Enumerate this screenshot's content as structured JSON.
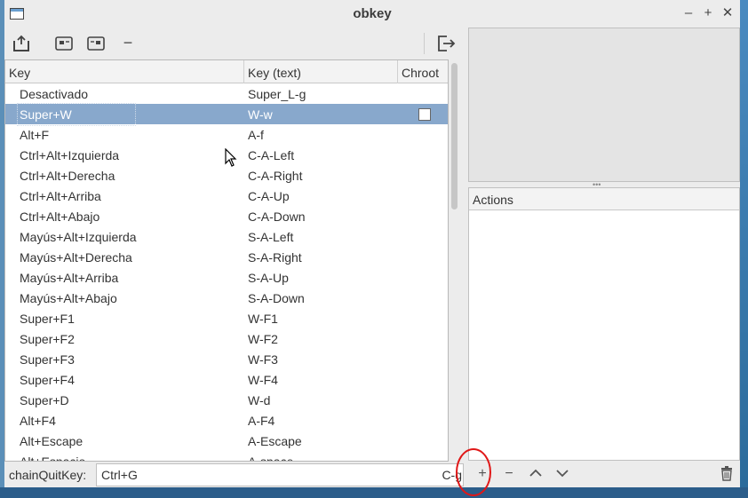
{
  "window": {
    "title": "obkey"
  },
  "toolbar": {
    "buttons": [
      {
        "icon": "load-icon"
      },
      {
        "icon": "copy-keybinding-icon"
      },
      {
        "icon": "copy-chain-icon"
      },
      {
        "icon": "remove-icon",
        "label": "−"
      },
      {
        "icon": "quit-icon"
      }
    ]
  },
  "table": {
    "columns": [
      "Key",
      "Key (text)",
      "Chroot"
    ],
    "rows": [
      {
        "key": "Desactivado",
        "text": "Super_L-g"
      },
      {
        "key": "Super+W",
        "text": "W-w",
        "chroot": false
      },
      {
        "key": "Alt+F",
        "text": "A-f"
      },
      {
        "key": "Ctrl+Alt+Izquierda",
        "text": "C-A-Left"
      },
      {
        "key": "Ctrl+Alt+Derecha",
        "text": "C-A-Right"
      },
      {
        "key": "Ctrl+Alt+Arriba",
        "text": "C-A-Up"
      },
      {
        "key": "Ctrl+Alt+Abajo",
        "text": "C-A-Down"
      },
      {
        "key": "Mayús+Alt+Izquierda",
        "text": "S-A-Left"
      },
      {
        "key": "Mayús+Alt+Derecha",
        "text": "S-A-Right"
      },
      {
        "key": "Mayús+Alt+Arriba",
        "text": "S-A-Up"
      },
      {
        "key": "Mayús+Alt+Abajo",
        "text": "S-A-Down"
      },
      {
        "key": "Super+F1",
        "text": "W-F1"
      },
      {
        "key": "Super+F2",
        "text": "W-F2"
      },
      {
        "key": "Super+F3",
        "text": "W-F3"
      },
      {
        "key": "Super+F4",
        "text": "W-F4"
      },
      {
        "key": "Super+D",
        "text": "W-d"
      },
      {
        "key": "Alt+F4",
        "text": "A-F4"
      },
      {
        "key": "Alt+Escape",
        "text": "A-Escape"
      },
      {
        "key": "Alt+Espacio",
        "text": "A-space"
      }
    ],
    "selected_row": "Super+W"
  },
  "status": {
    "label": "chainQuitKey:",
    "value": "Ctrl+G",
    "code": "C-g"
  },
  "actions": {
    "header": "Actions",
    "buttons": {
      "add": "+",
      "remove": "−"
    }
  },
  "colors": {
    "selection": "#88a8cc",
    "annotation": "#e01818"
  }
}
